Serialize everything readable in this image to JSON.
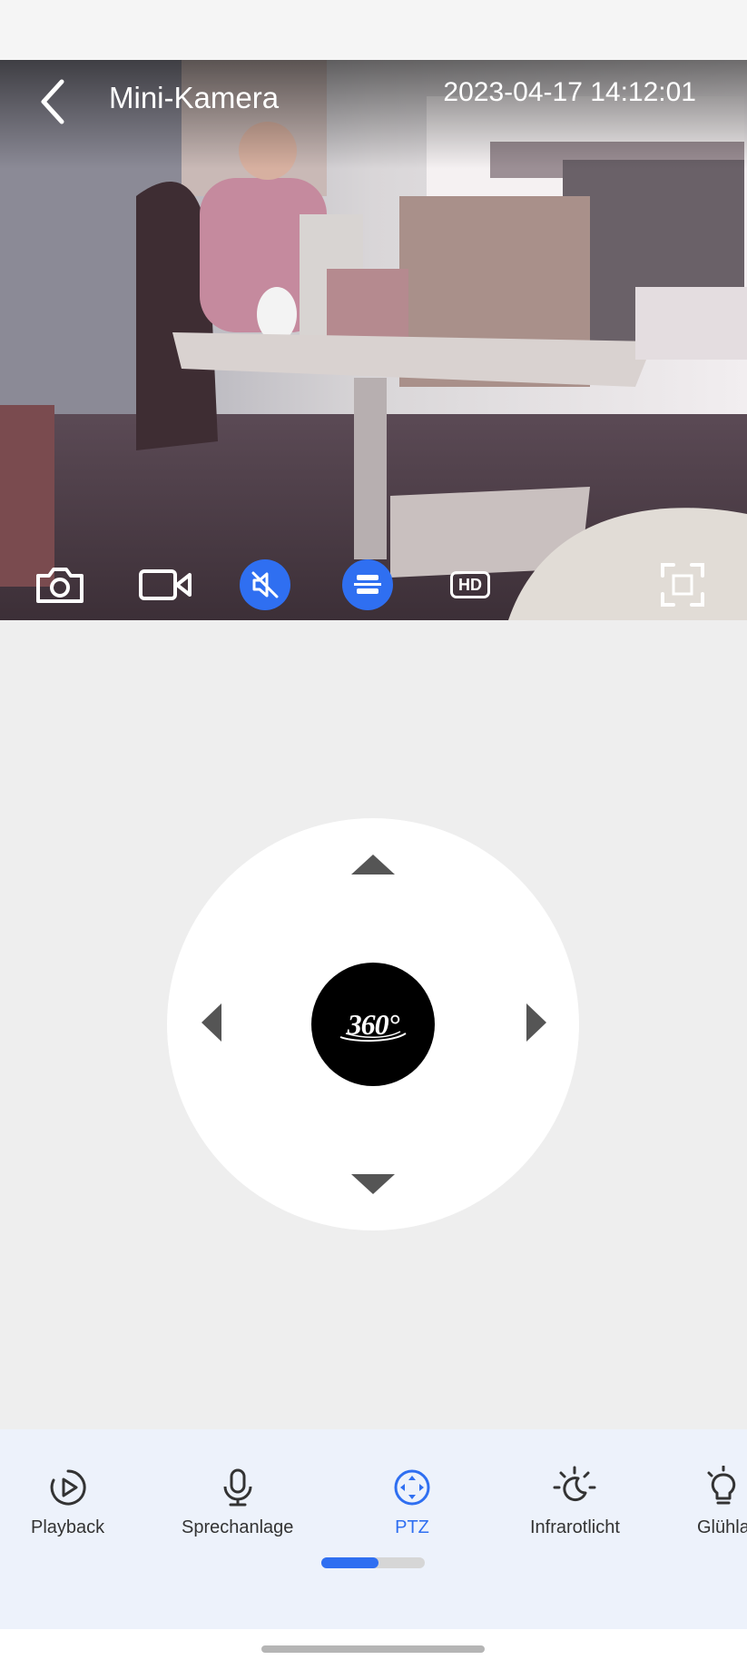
{
  "header": {
    "title": "Mini-Kamera",
    "timestamp": "2023-04-17 14:12:01"
  },
  "video_toolbar": {
    "items": [
      {
        "name": "camera-icon",
        "active": false
      },
      {
        "name": "video-record-icon",
        "active": false
      },
      {
        "name": "speaker-muted-icon",
        "active": true
      },
      {
        "name": "flip-image-icon",
        "active": true
      },
      {
        "name": "hd-icon",
        "label": "HD",
        "active": false
      },
      {
        "name": "fullscreen-icon",
        "active": false
      }
    ]
  },
  "ptz": {
    "center_label": "360°",
    "directions": [
      "up",
      "down",
      "left",
      "right"
    ]
  },
  "bottom_nav": {
    "items": [
      {
        "label": "Playback",
        "icon": "play-circle-icon",
        "active": false
      },
      {
        "label": "Sprechanlage",
        "icon": "microphone-icon",
        "active": false
      },
      {
        "label": "PTZ",
        "icon": "ptz-icon",
        "active": true
      },
      {
        "label": "Infrarotlicht",
        "icon": "moon-light-icon",
        "active": false
      },
      {
        "label": "Glühla",
        "icon": "bulb-icon",
        "active": false
      }
    ],
    "page_progress": 0.55
  },
  "colors": {
    "accent": "#2f6ff1",
    "nav_background": "#edf2fb",
    "page_background": "#eeeeee"
  }
}
